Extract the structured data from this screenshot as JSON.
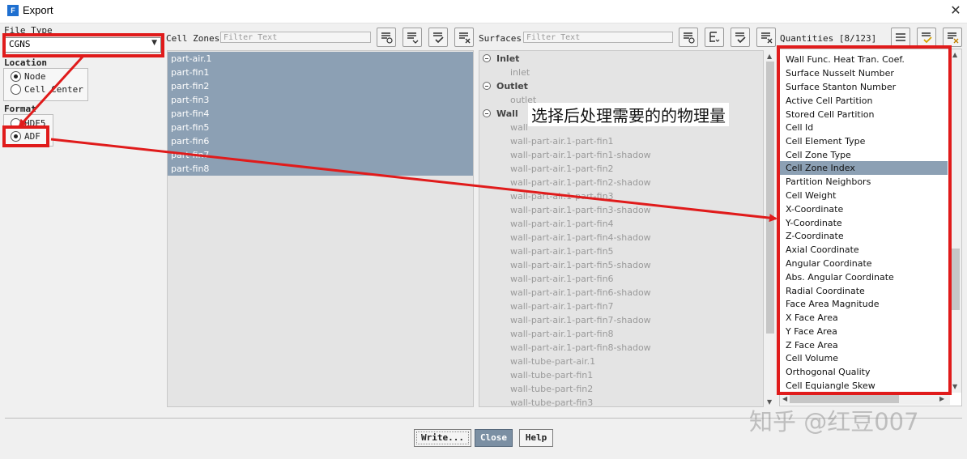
{
  "window": {
    "title": "Export",
    "app_icon_letter": "F"
  },
  "file_type": {
    "label": "File Type",
    "value": "CGNS"
  },
  "location": {
    "label": "Location",
    "options": [
      "Node",
      "Cell Center"
    ],
    "selected": "Node"
  },
  "format": {
    "label": "Format",
    "options": [
      "HDF5",
      "ADF"
    ],
    "selected": "ADF"
  },
  "cell_zones": {
    "label": "Cell Zones",
    "filter_placeholder": "Filter Text",
    "items": [
      "part-air.1",
      "part-fin1",
      "part-fin2",
      "part-fin3",
      "part-fin4",
      "part-fin5",
      "part-fin6",
      "part-fin7",
      "part-fin8"
    ]
  },
  "surfaces": {
    "label": "Surfaces",
    "filter_placeholder": "Filter Text",
    "groups": [
      {
        "name": "Inlet",
        "items": [
          "inlet"
        ]
      },
      {
        "name": "Outlet",
        "items": [
          "outlet"
        ]
      },
      {
        "name": "Wall",
        "items": [
          "wall",
          "wall-part-air.1-part-fin1",
          "wall-part-air.1-part-fin1-shadow",
          "wall-part-air.1-part-fin2",
          "wall-part-air.1-part-fin2-shadow",
          "wall-part-air.1-part-fin3",
          "wall-part-air.1-part-fin3-shadow",
          "wall-part-air.1-part-fin4",
          "wall-part-air.1-part-fin4-shadow",
          "wall-part-air.1-part-fin5",
          "wall-part-air.1-part-fin5-shadow",
          "wall-part-air.1-part-fin6",
          "wall-part-air.1-part-fin6-shadow",
          "wall-part-air.1-part-fin7",
          "wall-part-air.1-part-fin7-shadow",
          "wall-part-air.1-part-fin8",
          "wall-part-air.1-part-fin8-shadow",
          "wall-tube-part-air.1",
          "wall-tube-part-fin1",
          "wall-tube-part-fin2",
          "wall-tube-part-fin3"
        ]
      }
    ]
  },
  "quantities": {
    "label": "Quantities [8/123]",
    "selected_item": "Cell Zone Index",
    "items": [
      "Wall Func. Heat Tran. Coef.",
      "Surface Nusselt Number",
      "Surface Stanton Number",
      "Active Cell Partition",
      "Stored Cell Partition",
      "Cell Id",
      "Cell Element Type",
      "Cell Zone Type",
      "Cell Zone Index",
      "Partition Neighbors",
      "Cell Weight",
      "X-Coordinate",
      "Y-Coordinate",
      "Z-Coordinate",
      "Axial Coordinate",
      "Angular Coordinate",
      "Abs. Angular Coordinate",
      "Radial Coordinate",
      "Face Area Magnitude",
      "X Face Area",
      "Y Face Area",
      "Z Face Area",
      "Cell Volume",
      "Orthogonal Quality",
      "Cell Equiangle Skew"
    ]
  },
  "buttons": {
    "write": "Write...",
    "close": "Close",
    "help": "Help"
  },
  "annotation": {
    "text": "选择后处理需要的的物理量",
    "color": "#e01b1b"
  },
  "watermark": "知乎 @红豆007",
  "colors": {
    "selection": "#8ca0b4",
    "annotation_red": "#e01b1b",
    "list_bg": "#e4e4e4"
  }
}
